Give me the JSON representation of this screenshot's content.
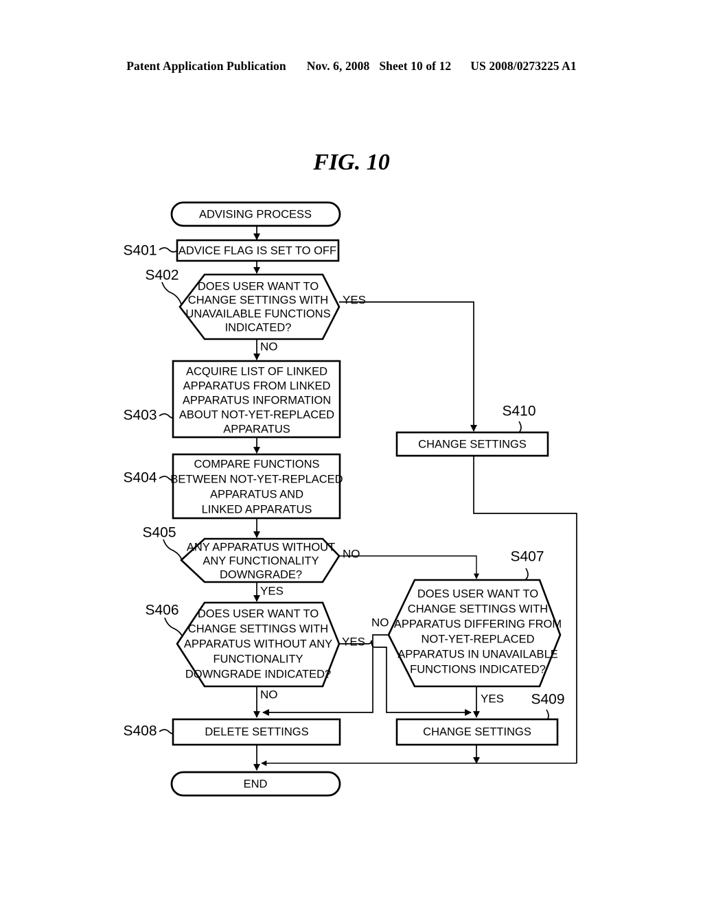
{
  "header": {
    "publication": "Patent Application Publication",
    "date": "Nov. 6, 2008",
    "sheet": "Sheet 10 of 12",
    "patent_number": "US 2008/0273225 A1"
  },
  "figure": {
    "title": "FIG. 10"
  },
  "colors": {
    "ink": "#000000",
    "paper": "#ffffff"
  },
  "chart_data": {
    "type": "diagram",
    "subtype": "flowchart",
    "title": "FIG. 10",
    "nodes": [
      {
        "id": "start",
        "shape": "terminator",
        "step": "",
        "lines": [
          "ADVISING PROCESS"
        ]
      },
      {
        "id": "s401",
        "shape": "process",
        "step": "S401",
        "lines": [
          "ADVICE FLAG IS SET TO OFF"
        ]
      },
      {
        "id": "s402",
        "shape": "decision-hex",
        "step": "S402",
        "lines": [
          "DOES USER WANT TO",
          "CHANGE SETTINGS WITH",
          "UNAVAILABLE FUNCTIONS",
          "INDICATED?"
        ]
      },
      {
        "id": "s403",
        "shape": "process",
        "step": "S403",
        "lines": [
          "ACQUIRE LIST OF LINKED",
          "APPARATUS FROM LINKED",
          "APPARATUS INFORMATION",
          "ABOUT NOT-YET-REPLACED",
          "APPARATUS"
        ]
      },
      {
        "id": "s404",
        "shape": "process",
        "step": "S404",
        "lines": [
          "COMPARE FUNCTIONS",
          "BETWEEN NOT-YET-REPLACED",
          "APPARATUS AND",
          "LINKED APPARATUS"
        ]
      },
      {
        "id": "s405",
        "shape": "decision-hex",
        "step": "S405",
        "lines": [
          "ANY APPARATUS WITHOUT",
          "ANY FUNCTIONALITY",
          "DOWNGRADE?"
        ]
      },
      {
        "id": "s406",
        "shape": "decision-hex",
        "step": "S406",
        "lines": [
          "DOES USER WANT TO",
          "CHANGE SETTINGS WITH",
          "APPARATUS WITHOUT ANY",
          "FUNCTIONALITY",
          "DOWNGRADE INDICATED?"
        ]
      },
      {
        "id": "s407",
        "shape": "decision-hex",
        "step": "S407",
        "lines": [
          "DOES USER WANT TO",
          "CHANGE SETTINGS WITH",
          "APPARATUS DIFFERING FROM",
          "NOT-YET-REPLACED",
          "APPARATUS IN UNAVAILABLE",
          "FUNCTIONS INDICATED?"
        ]
      },
      {
        "id": "s408",
        "shape": "process",
        "step": "S408",
        "lines": [
          "DELETE SETTINGS"
        ]
      },
      {
        "id": "s409",
        "shape": "process",
        "step": "S409",
        "lines": [
          "CHANGE SETTINGS"
        ]
      },
      {
        "id": "s410",
        "shape": "process",
        "step": "S410",
        "lines": [
          "CHANGE SETTINGS"
        ]
      },
      {
        "id": "end",
        "shape": "terminator",
        "step": "",
        "lines": [
          "END"
        ]
      }
    ],
    "edges": [
      {
        "from": "start",
        "to": "s401",
        "label": ""
      },
      {
        "from": "s401",
        "to": "s402",
        "label": ""
      },
      {
        "from": "s402",
        "to": "s403",
        "label": "NO"
      },
      {
        "from": "s402",
        "to": "s410",
        "label": "YES"
      },
      {
        "from": "s403",
        "to": "s404",
        "label": ""
      },
      {
        "from": "s404",
        "to": "s405",
        "label": ""
      },
      {
        "from": "s405",
        "to": "s406",
        "label": "YES"
      },
      {
        "from": "s405",
        "to": "s407",
        "label": "NO"
      },
      {
        "from": "s406",
        "to": "s408",
        "label": "NO"
      },
      {
        "from": "s406",
        "to": "s409",
        "label": "YES"
      },
      {
        "from": "s407",
        "to": "s408",
        "label": "NO"
      },
      {
        "from": "s407",
        "to": "s409",
        "label": "YES"
      },
      {
        "from": "s408",
        "to": "end",
        "label": ""
      },
      {
        "from": "s409",
        "to": "end",
        "label": ""
      },
      {
        "from": "s410",
        "to": "end",
        "label": ""
      }
    ]
  },
  "flowchart": {
    "start": {
      "text": "ADVISING PROCESS"
    },
    "end": {
      "text": "END"
    },
    "s401": {
      "step": "S401",
      "l0": "ADVICE FLAG IS SET TO OFF"
    },
    "s402": {
      "step": "S402",
      "l0": "DOES USER WANT TO",
      "l1": "CHANGE SETTINGS WITH",
      "l2": "UNAVAILABLE FUNCTIONS",
      "l3": "INDICATED?",
      "yes": "YES",
      "no": "NO"
    },
    "s403": {
      "step": "S403",
      "l0": "ACQUIRE LIST OF LINKED",
      "l1": "APPARATUS FROM LINKED",
      "l2": "APPARATUS INFORMATION",
      "l3": "ABOUT NOT-YET-REPLACED",
      "l4": "APPARATUS"
    },
    "s404": {
      "step": "S404",
      "l0": "COMPARE FUNCTIONS",
      "l1": "BETWEEN NOT-YET-REPLACED",
      "l2": "APPARATUS AND",
      "l3": "LINKED APPARATUS"
    },
    "s405": {
      "step": "S405",
      "l0": "ANY APPARATUS WITHOUT",
      "l1": "ANY FUNCTIONALITY",
      "l2": "DOWNGRADE?",
      "yes": "YES",
      "no": "NO"
    },
    "s406": {
      "step": "S406",
      "l0": "DOES USER WANT TO",
      "l1": "CHANGE SETTINGS WITH",
      "l2": "APPARATUS WITHOUT ANY",
      "l3": "FUNCTIONALITY",
      "l4": "DOWNGRADE INDICATED?",
      "yes": "YES",
      "no": "NO"
    },
    "s407": {
      "step": "S407",
      "l0": "DOES USER WANT TO",
      "l1": "CHANGE SETTINGS WITH",
      "l2": "APPARATUS DIFFERING FROM",
      "l3": "NOT-YET-REPLACED",
      "l4": "APPARATUS IN UNAVAILABLE",
      "l5": "FUNCTIONS INDICATED?",
      "yes": "YES",
      "no": "NO"
    },
    "s408": {
      "step": "S408",
      "l0": "DELETE SETTINGS"
    },
    "s409": {
      "step": "S409",
      "l0": "CHANGE SETTINGS"
    },
    "s410": {
      "step": "S410",
      "l0": "CHANGE SETTINGS"
    }
  }
}
